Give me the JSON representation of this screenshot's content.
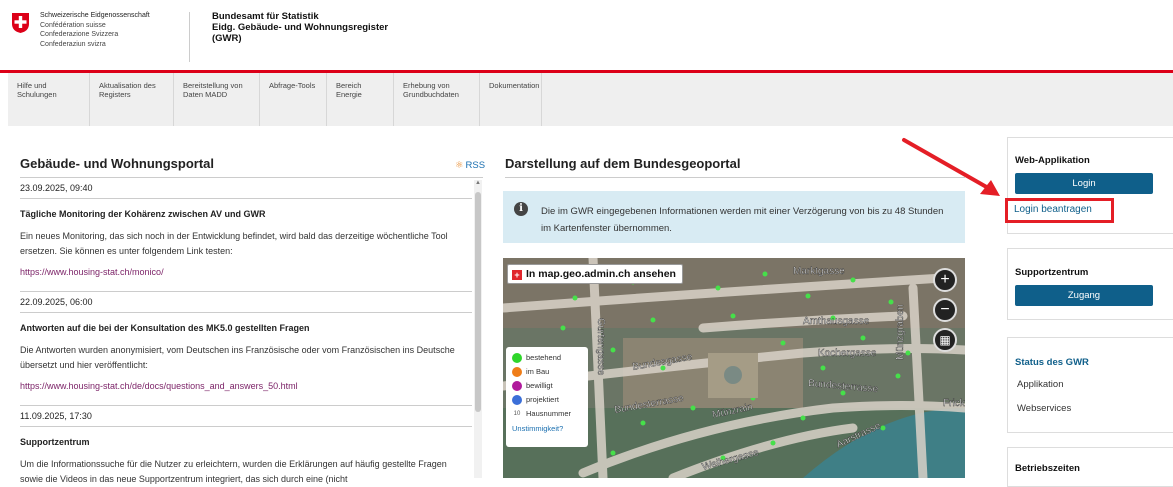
{
  "header": {
    "confederation": [
      "Schweizerische Eidgenossenschaft",
      "Confédération suisse",
      "Confederazione Svizzera",
      "Confederaziun svizra"
    ],
    "office": [
      "Bundesamt für Statistik",
      "Eidg. Gebäude- und Wohnungsregister",
      "(GWR)"
    ]
  },
  "nav": [
    {
      "line1": "Hilfe und",
      "line2": "Schulungen"
    },
    {
      "line1": "Aktualisation des",
      "line2": "Registers"
    },
    {
      "line1": "Bereitstellung von",
      "line2": "Daten MADD"
    },
    {
      "line1": "Abfrage-Tools",
      "line2": ""
    },
    {
      "line1": "Bereich Energie",
      "line2": ""
    },
    {
      "line1": "Erhebung von",
      "line2": "Grundbuchdaten"
    },
    {
      "line1": "Dokumentation",
      "line2": ""
    }
  ],
  "portal": {
    "title": "Gebäude- und Wohnungsportal",
    "rss": "RSS",
    "news": [
      {
        "date": "23.09.2025, 09:40",
        "title": "Tägliche Monitoring der Kohärenz zwischen AV und GWR",
        "body": "Ein neues Monitoring, das sich noch in der Entwicklung befindet, wird bald das derzeitige wöchentliche Tool ersetzen. Sie können es unter folgendem Link testen:",
        "link": "https://www.housing-stat.ch/monico/"
      },
      {
        "date": "22.09.2025, 06:00",
        "title": "Antworten auf die bei der Konsultation des MK5.0 gestellten Fragen",
        "body": "Die Antworten wurden anonymisiert, vom Deutschen ins Französische oder vom Französischen ins Deutsche übersetzt und hier veröffentlicht:",
        "link": "https://www.housing-stat.ch/de/docs/questions_and_answers_50.html"
      },
      {
        "date": "11.09.2025, 17:30",
        "title": "Supportzentrum",
        "body": "Um die Informationssuche für die Nutzer zu erleichtern, wurden die Erklärungen auf häufig gestellte Fragen sowie die Videos in das neue Supportzentrum integriert, das sich durch eine (nicht"
      }
    ]
  },
  "geoportal": {
    "title": "Darstellung auf dem Bundesgeoportal",
    "info": "Die im GWR eingegebenen Informationen werden mit einer Verzögerung von bis zu 48 Stunden im Kartenfenster übernommen.",
    "map_button": "In map.geo.admin.ch ansehen",
    "streets": [
      "Marktgasse",
      "Amthausgasse",
      "Kochergasse",
      "Bundesgasse",
      "Bundesterrasse",
      "Bundesterrasse",
      "Münzrain",
      "Aarstrasse",
      "Gurtengasse",
      "Münzgraben",
      "Weihergasse",
      "Frick"
    ],
    "legend": [
      {
        "label": "bestehend",
        "color": "#2fd62b"
      },
      {
        "label": "im Bau",
        "color": "#ef7d18"
      },
      {
        "label": "bewilligt",
        "color": "#b01a9c"
      },
      {
        "label": "projektiert",
        "color": "#3b6fd8"
      }
    ],
    "legend_number": "10",
    "legend_number_label": "Hausnummer",
    "legend_link": "Unstimmigkeit?"
  },
  "sidebar": {
    "webapp_title": "Web-Applikation",
    "login_button": "Login",
    "login_request": "Login beantragen",
    "support_title": "Supportzentrum",
    "support_button": "Zugang",
    "status_title": "Status des GWR",
    "status_items": [
      "Applikation",
      "Webservices"
    ],
    "hours_title": "Betriebszeiten"
  },
  "colors": {
    "accent_red": "#dc0018",
    "button_blue": "#0f5f8a",
    "link_purple": "#7a1f65",
    "info_bg": "#d8ebf3"
  }
}
